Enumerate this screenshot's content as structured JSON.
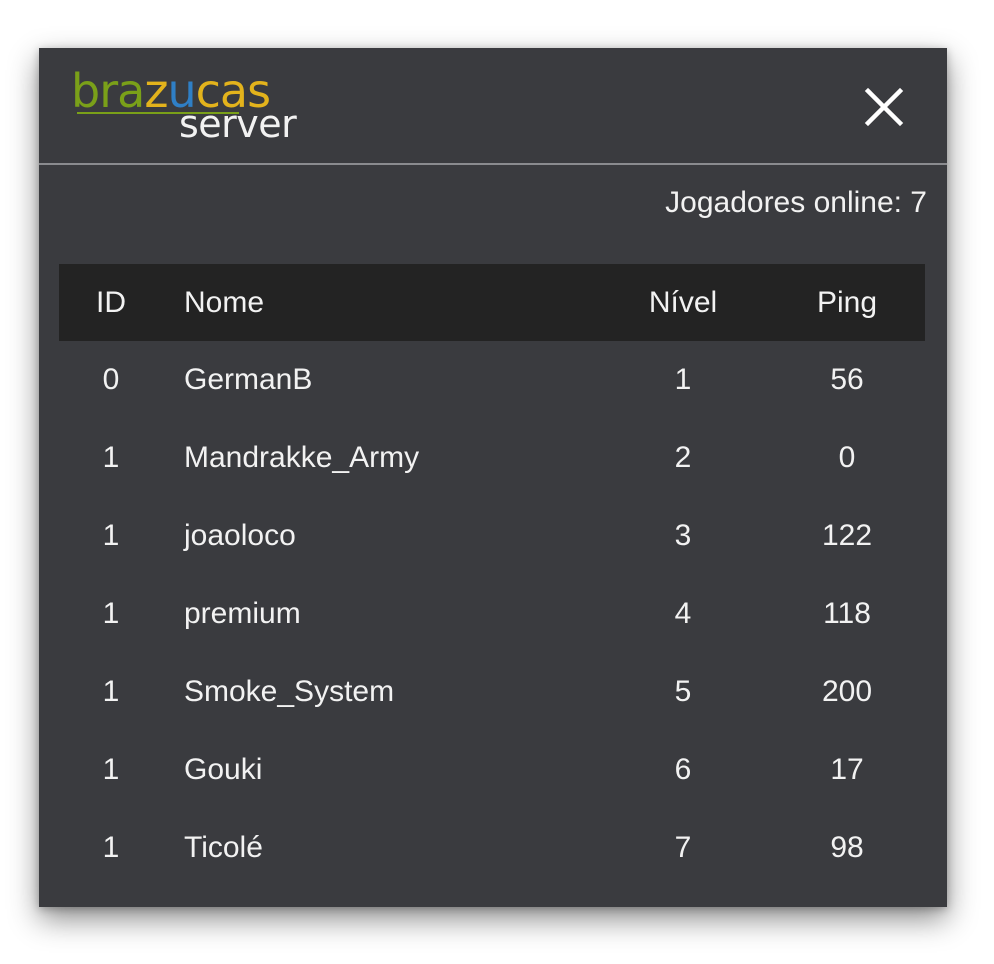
{
  "window": {
    "logo": {
      "word_parts": [
        "bra",
        "z",
        "u",
        "cas"
      ],
      "subtitle": "server",
      "colors": {
        "green": "#7aa019",
        "yellow": "#e3b31c",
        "blue": "#2f7fc6"
      }
    },
    "close_icon": "close-icon"
  },
  "status": {
    "online_label": "Jogadores online: 7"
  },
  "table": {
    "headers": {
      "id": "ID",
      "nome": "Nome",
      "nivel": "Nível",
      "ping": "Ping"
    },
    "rows": [
      {
        "id": "0",
        "nome": "GermanB",
        "nivel": "1",
        "ping": "56"
      },
      {
        "id": "1",
        "nome": "Mandrakke_Army",
        "nivel": "2",
        "ping": "0"
      },
      {
        "id": "1",
        "nome": "joaoloco",
        "nivel": "3",
        "ping": "122"
      },
      {
        "id": "1",
        "nome": "premium",
        "nivel": "4",
        "ping": "118"
      },
      {
        "id": "1",
        "nome": "Smoke_System",
        "nivel": "5",
        "ping": "200"
      },
      {
        "id": "1",
        "nome": "Gouki",
        "nivel": "6",
        "ping": "17"
      },
      {
        "id": "1",
        "nome": "Ticolé",
        "nivel": "7",
        "ping": "98"
      }
    ]
  },
  "colors": {
    "panel_bg": "#3a3b3f",
    "header_row_bg": "#232323",
    "text": "#f2f2f2"
  }
}
